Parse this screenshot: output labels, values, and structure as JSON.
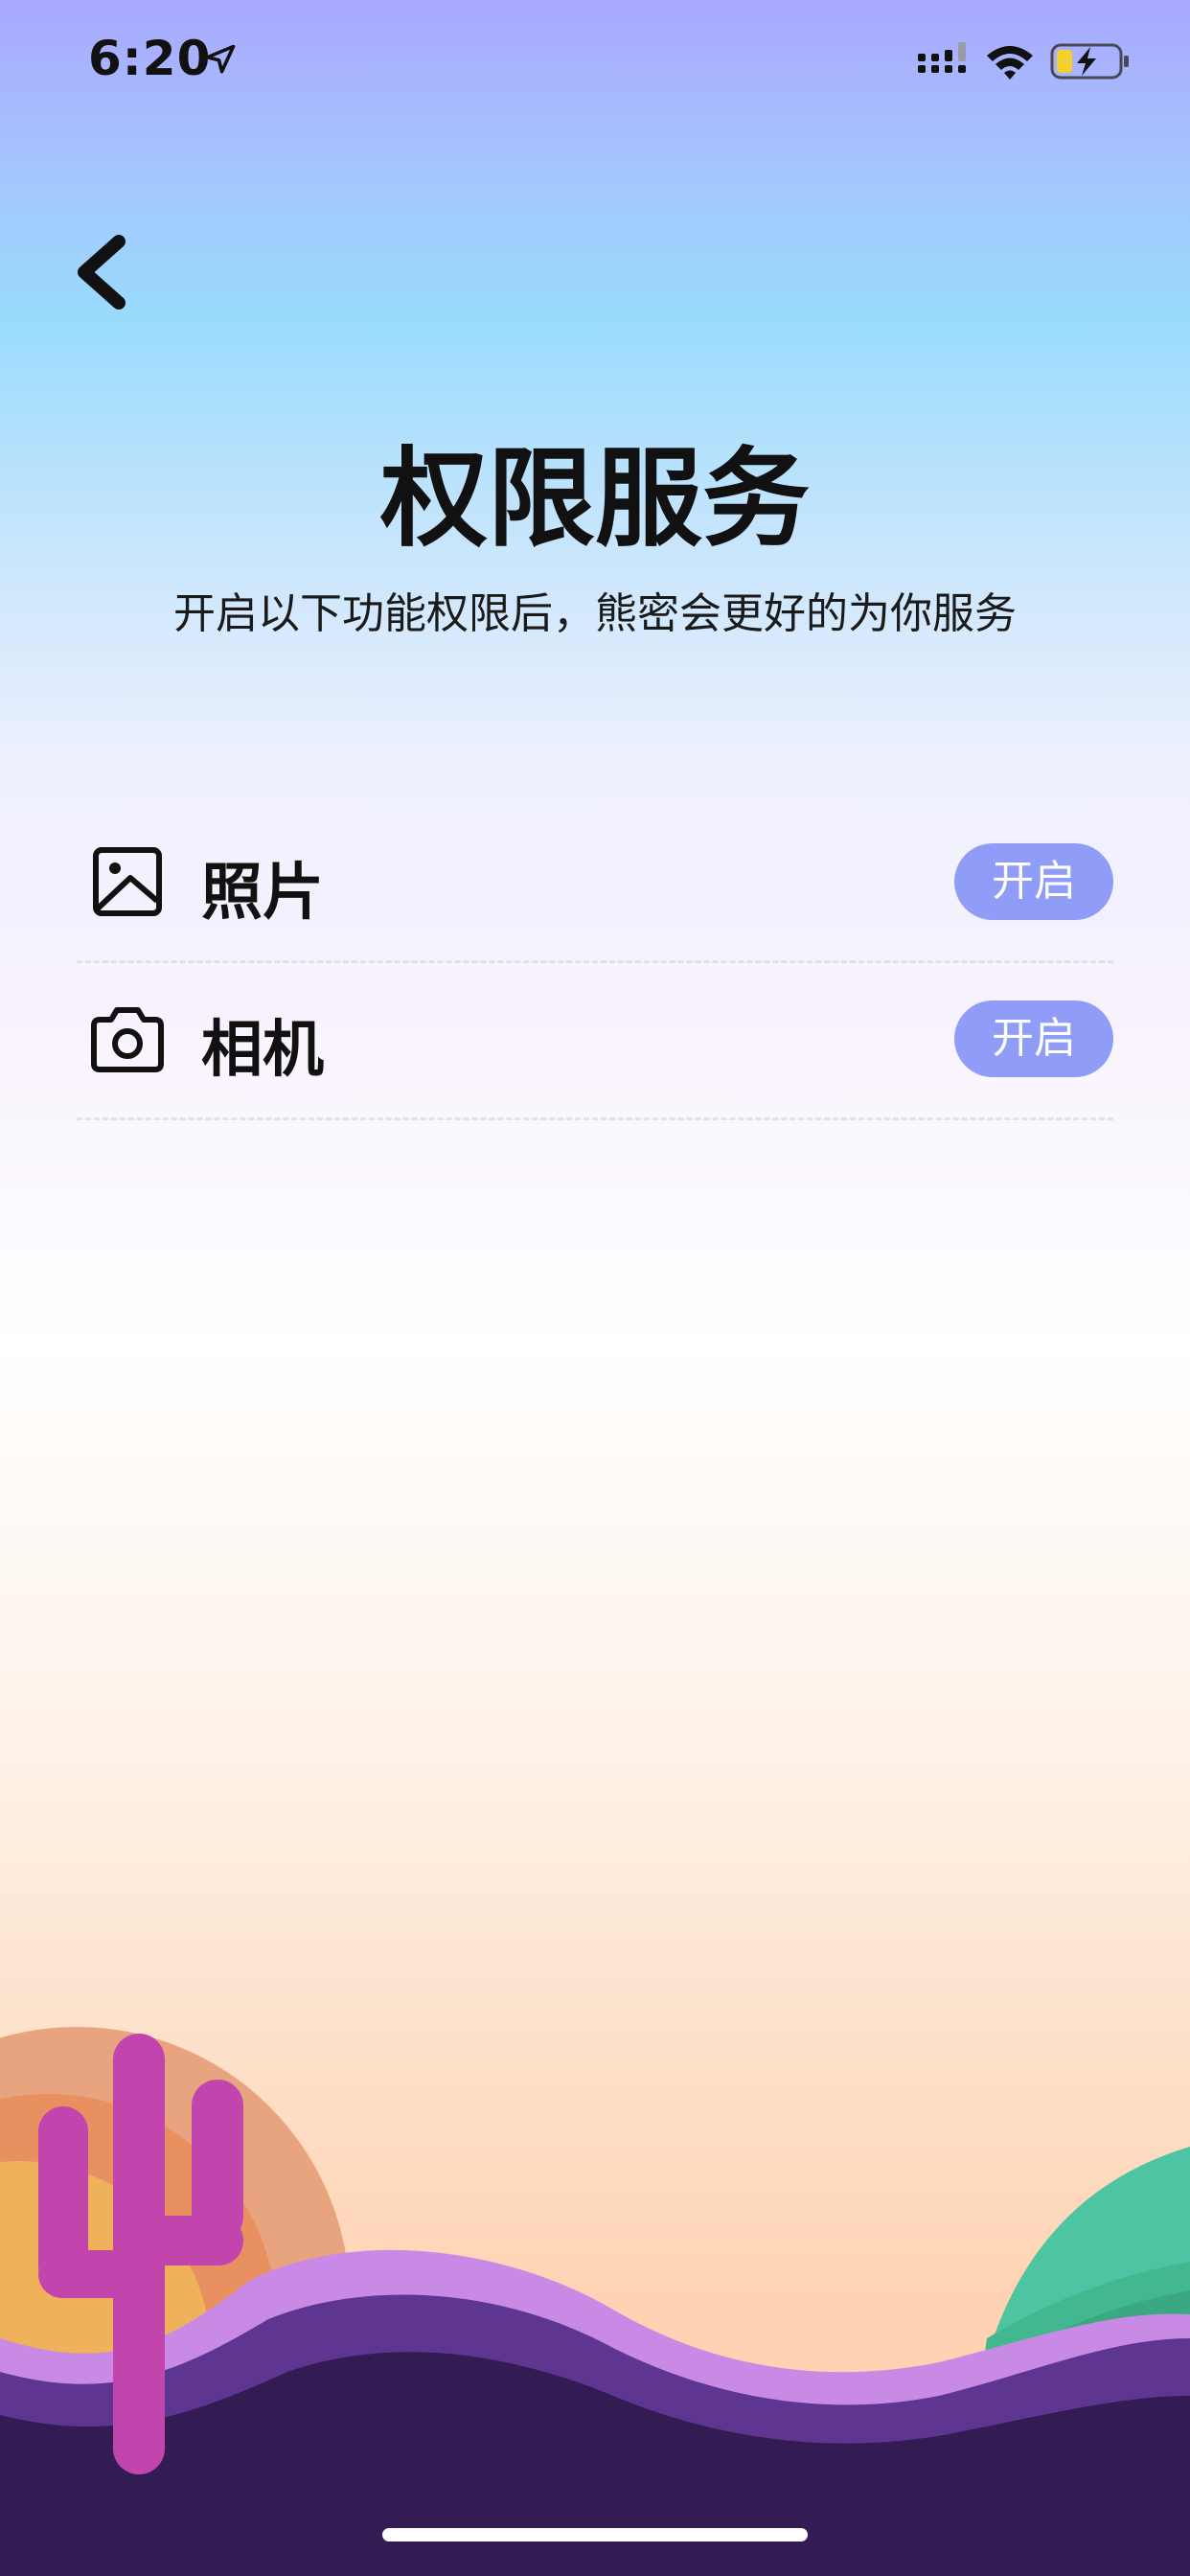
{
  "status_bar": {
    "time": "6:20",
    "icons": [
      "location-arrow-icon",
      "cellular-signal-icon",
      "wifi-icon",
      "battery-charging-icon"
    ]
  },
  "header": {
    "back_icon": "chevron-left-icon",
    "title": "权限服务",
    "subtitle": "开启以下功能权限后，熊密会更好的为你服务"
  },
  "permissions": [
    {
      "icon": "photo-icon",
      "label": "照片",
      "button_label": "开启"
    },
    {
      "icon": "camera-icon",
      "label": "相机",
      "button_label": "开启"
    }
  ],
  "colors": {
    "accent_button": "#8f9df9",
    "title_text": "#111111",
    "cactus": "#c145ad",
    "wave_purple_light": "#c98ae6",
    "wave_purple_dark": "#331c53",
    "hill_green": "#3fae88"
  }
}
